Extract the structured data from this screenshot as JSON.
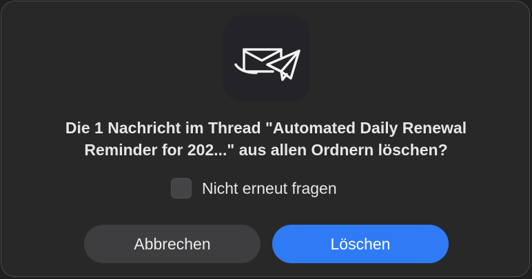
{
  "dialog": {
    "icon": "mail-app-icon",
    "message_line_1": "Die 1 Nachricht im Thread \"Automated Daily Renewal",
    "message_line_2": "Reminder for 202...\" aus allen Ordnern löschen?",
    "checkbox": {
      "label": "Nicht erneut fragen",
      "checked": false
    },
    "buttons": {
      "cancel_label": "Abbrechen",
      "delete_label": "Löschen"
    }
  },
  "colors": {
    "background": "#282828",
    "primary_button": "#2f7bf5",
    "secondary_button": "#3e3e40"
  }
}
